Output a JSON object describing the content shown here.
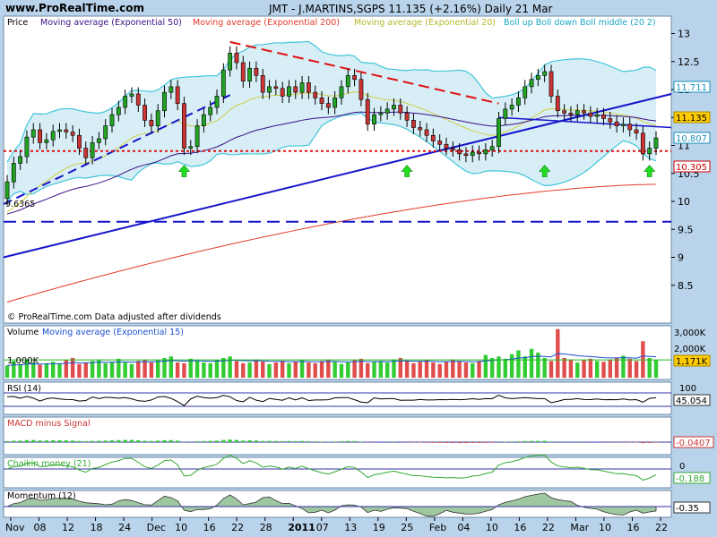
{
  "site": "www.ProRealTime.com",
  "title": "JMT - J.MARTINS,SGPS   11.135 (+2.16%)   Daily  21 Mar",
  "colors": {
    "bg": "#b9d3ea",
    "panel": "#ffffff",
    "up": "#22a422",
    "down": "#cc3333",
    "ema50": "#3b0f88",
    "ema200": "#e23a2a",
    "ema20": "#cfcf40",
    "boll": "#40c6d8",
    "trend": "#1414cc",
    "vol_up": "#33cc33",
    "vol_down": "#e04d4d"
  },
  "legend": {
    "price": "Price",
    "ema50": "Moving average (Exponential 50)",
    "ema200": "Moving average (Exponential 200)",
    "ema20": "Moving average (Exponential 20)",
    "boll": "Boll up Boll down Boll middle (20 2)",
    "copyright": "© ProRealTime.com  Data adjusted after dividends"
  },
  "price_axis": {
    "ticks": [
      "13",
      "12.5",
      "12",
      "11.5",
      "11",
      "10.5",
      "10",
      "9.5",
      "9",
      "8.5"
    ]
  },
  "badges": [
    {
      "text": "11.711",
      "fg": "#1a8fb8",
      "bg": "#ffffff"
    },
    {
      "text": "11.135",
      "fg": "#000000",
      "bg": "#ffcc00"
    },
    {
      "text": "10.807",
      "fg": "#1a8fb8",
      "bg": "#ffffff"
    },
    {
      "text": "10.305",
      "fg": "#cc0000",
      "bg": "#ffffff"
    }
  ],
  "level_label": "9.6365",
  "volume": {
    "title": "Volume",
    "ma_title": "Moving average (Exponential 15)",
    "ticks": [
      "3,000K",
      "2,000K",
      "1,000K"
    ],
    "ma_badge": "1,171K"
  },
  "rsi": {
    "title": "RSI (14)",
    "tick": "100",
    "badge": "45.054"
  },
  "macd": {
    "title": "MACD minus Signal",
    "badge": "-0.0407"
  },
  "chaikin": {
    "title": "Chaikin money (21)",
    "tick": "0",
    "badge": "-0.188"
  },
  "momentum": {
    "title": "Momentum (12)",
    "badge": "-0.35"
  },
  "x_axis": {
    "labels": [
      "Nov",
      "08",
      "12",
      "18",
      "24",
      "Dec",
      "10",
      "16",
      "22",
      "28",
      "2011",
      "07",
      "13",
      "19",
      "25",
      "Feb",
      "04",
      "10",
      "16",
      "22",
      "Mar",
      "10",
      "16",
      "22"
    ]
  },
  "chart_data": {
    "type": "candlestick",
    "title": "JMT - J.MARTINS,SGPS 11.135 (+2.16%) Daily 21 Mar",
    "ylim": [
      8.0,
      13.2
    ],
    "last_close": 11.135,
    "change_pct": 2.16,
    "closes": [
      10.35,
      10.68,
      10.8,
      11.15,
      11.28,
      11.05,
      11.1,
      11.25,
      11.28,
      11.24,
      11.18,
      10.95,
      10.78,
      11.05,
      11.12,
      11.35,
      11.55,
      11.68,
      11.88,
      11.92,
      11.72,
      11.45,
      11.35,
      11.62,
      11.95,
      12.05,
      11.75,
      10.95,
      10.98,
      11.35,
      11.55,
      11.68,
      11.88,
      12.35,
      12.65,
      12.48,
      12.15,
      12.38,
      12.25,
      11.95,
      12.05,
      12.02,
      11.88,
      12.05,
      11.95,
      12.12,
      11.95,
      11.85,
      11.75,
      11.68,
      11.85,
      12.05,
      12.25,
      12.18,
      11.82,
      11.38,
      11.55,
      11.58,
      11.65,
      11.72,
      11.58,
      11.45,
      11.32,
      11.28,
      11.18,
      11.08,
      11.02,
      10.95,
      10.92,
      10.85,
      10.82,
      10.88,
      10.85,
      10.92,
      10.98,
      11.48,
      11.65,
      11.72,
      11.85,
      12.05,
      12.18,
      12.25,
      12.32,
      11.88,
      11.62,
      11.58,
      11.55,
      11.62,
      11.58,
      11.52,
      11.55,
      11.48,
      11.42,
      11.35,
      11.38,
      11.28,
      11.22,
      10.85,
      10.95,
      11.135
    ],
    "opens": [
      10.05,
      10.35,
      10.68,
      10.8,
      11.15,
      11.28,
      11.05,
      11.1,
      11.25,
      11.28,
      11.24,
      11.18,
      10.95,
      10.78,
      11.05,
      11.12,
      11.35,
      11.55,
      11.68,
      11.88,
      11.92,
      11.72,
      11.45,
      11.35,
      11.62,
      11.95,
      12.05,
      11.75,
      10.95,
      10.98,
      11.35,
      11.55,
      11.68,
      11.88,
      12.35,
      12.65,
      12.48,
      12.15,
      12.38,
      12.25,
      11.95,
      12.05,
      12.02,
      11.88,
      12.05,
      11.95,
      12.12,
      11.95,
      11.85,
      11.75,
      11.68,
      11.85,
      12.05,
      12.25,
      12.18,
      11.82,
      11.38,
      11.55,
      11.58,
      11.65,
      11.72,
      11.58,
      11.45,
      11.32,
      11.28,
      11.18,
      11.08,
      11.02,
      10.95,
      10.92,
      10.85,
      10.82,
      10.88,
      10.85,
      10.92,
      10.98,
      11.48,
      11.65,
      11.72,
      11.85,
      12.05,
      12.18,
      12.25,
      12.32,
      11.88,
      11.62,
      11.58,
      11.55,
      11.62,
      11.58,
      11.52,
      11.55,
      11.48,
      11.42,
      11.35,
      11.38,
      11.28,
      11.22,
      10.85,
      10.95
    ],
    "ema200": {
      "start": 8.2,
      "end": 10.305
    },
    "support_level": 10.9,
    "long_dash_level": 9.6365,
    "trendline": {
      "from": [
        0,
        9.0
      ],
      "to": [
        100,
        11.8
      ]
    },
    "arrows_at": [
      27,
      61,
      82,
      98
    ],
    "volume_k": [
      800,
      1100,
      900,
      1200,
      1000,
      850,
      950,
      1050,
      900,
      1150,
      1300,
      900,
      1000,
      1100,
      1200,
      950,
      1050,
      1250,
      1000,
      900,
      1100,
      1200,
      1000,
      1150,
      1300,
      1400,
      1000,
      950,
      1250,
      1100,
      1000,
      950,
      1150,
      1300,
      1400,
      1100,
      950,
      1000,
      1200,
      1050,
      900,
      1000,
      1100,
      950,
      1050,
      1150,
      1000,
      950,
      1100,
      1200,
      1050,
      900,
      1000,
      1150,
      1250,
      950,
      1050,
      1100,
      1000,
      1200,
      1300,
      1100,
      950,
      1050,
      1150,
      1000,
      900,
      1050,
      1200,
      1100,
      1000,
      950,
      1100,
      1500,
      1300,
      1400,
      1250,
      1550,
      1800,
      1400,
      1900,
      1650,
      1300,
      1100,
      3200,
      1300,
      1200,
      1000,
      1150,
      1250,
      1100,
      1050,
      1200,
      1300,
      1450,
      1250,
      1100,
      2400,
      1300,
      1150
    ]
  }
}
